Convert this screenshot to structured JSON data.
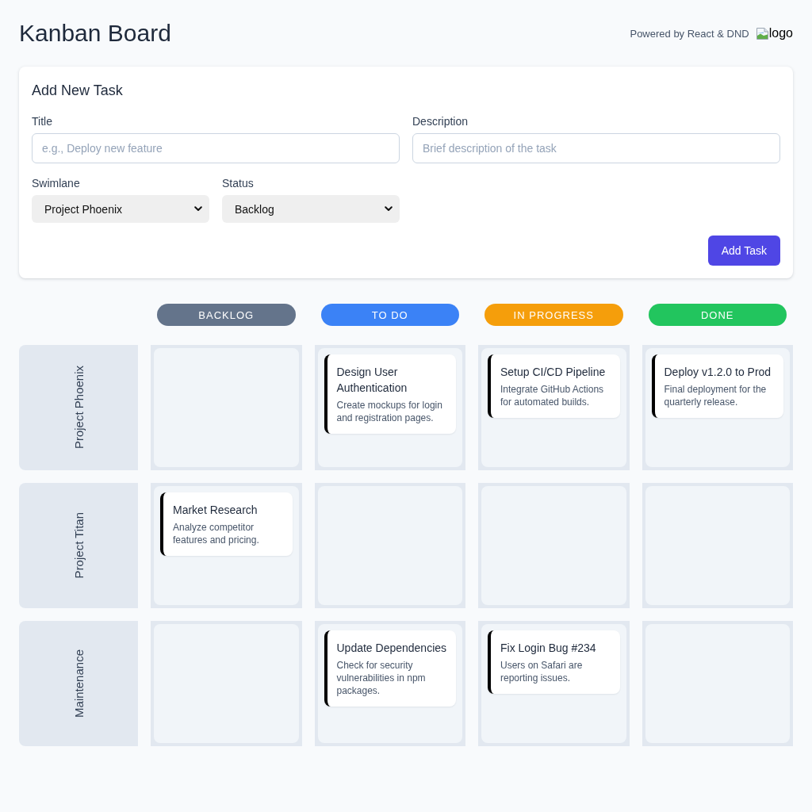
{
  "header": {
    "title": "Kanban Board",
    "powered_by": "Powered by React & DND",
    "logo_alt": "logo"
  },
  "form": {
    "title": "Add New Task",
    "fields": [
      {
        "kind": "input",
        "label": "Title",
        "placeholder": "e.g., Deploy new feature"
      },
      {
        "kind": "input",
        "label": "Description",
        "placeholder": "Brief description of the task"
      },
      {
        "kind": "select",
        "label": "Swimlane",
        "value": "Project Phoenix"
      },
      {
        "kind": "select",
        "label": "Status",
        "value": "Backlog"
      }
    ],
    "submit_button": "Add Task"
  },
  "board": {
    "columns": [
      {
        "label": "BACKLOG",
        "color": "#64748b"
      },
      {
        "label": "TO DO",
        "color": "#3b82f6"
      },
      {
        "label": "IN PROGRESS",
        "color": "#f59e0b"
      },
      {
        "label": "DONE",
        "color": "#22c55e"
      }
    ],
    "swimlanes": [
      {
        "name": "Project Phoenix",
        "cells": [
          {},
          {
            "cards": [
              {
                "title": "Design User Authentication",
                "description": "Create mockups for login and registration pages."
              }
            ]
          },
          {
            "cards": [
              {
                "title": "Setup CI/CD Pipeline",
                "description": "Integrate GitHub Actions for automated builds."
              }
            ]
          },
          {
            "cards": [
              {
                "title": "Deploy v1.2.0 to Prod",
                "description": "Final deployment for the quarterly release."
              }
            ]
          }
        ]
      },
      {
        "name": "Project Titan",
        "cells": [
          {
            "cards": [
              {
                "title": "Market Research",
                "description": "Analyze competitor features and pricing."
              }
            ]
          },
          {},
          {},
          {}
        ]
      },
      {
        "name": "Maintenance",
        "cells": [
          {},
          {
            "cards": [
              {
                "title": "Update Dependencies",
                "description": "Check for security vulnerabilities in npm packages."
              }
            ]
          },
          {
            "cards": [
              {
                "title": "Fix Login Bug #234",
                "description": "Users on Safari are reporting issues."
              }
            ]
          },
          {}
        ]
      }
    ]
  }
}
